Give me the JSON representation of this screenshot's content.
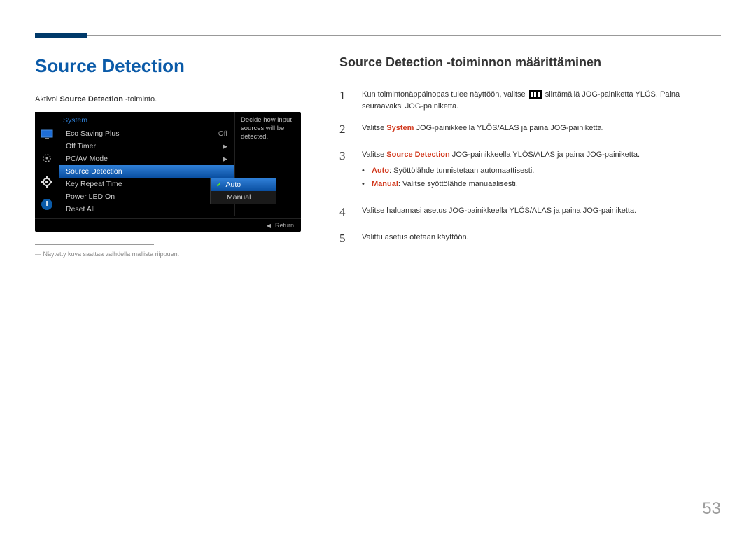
{
  "page_number": "53",
  "left": {
    "title": "Source Detection",
    "intro_pre": "Aktivoi ",
    "intro_bold": "Source Detection",
    "intro_post": " -toiminto.",
    "footnote": "Näytetty kuva saattaa vaihdella mallista riippuen."
  },
  "osd": {
    "header": "System",
    "rows": {
      "eco": "Eco Saving Plus",
      "eco_val": "Off",
      "offtimer": "Off Timer",
      "pcav": "PC/AV Mode",
      "srcdet": "Source Detection",
      "keyrep": "Key Repeat Time",
      "pled": "Power LED On",
      "reset": "Reset All"
    },
    "help": "Decide how input sources will be detected.",
    "dropdown": {
      "auto": "Auto",
      "manual": "Manual"
    },
    "return": "Return"
  },
  "right": {
    "heading": "Source Detection -toiminnon määrittäminen",
    "step1_a": "Kun toimintonäppäinopas tulee näyttöön, valitse ",
    "step1_b": " siirtämällä JOG-painiketta YLÖS. Paina seuraavaksi JOG-painiketta.",
    "step2_a": "Valitse ",
    "step2_sys": "System",
    "step2_b": " JOG-painikkeella YLÖS/ALAS ja paina JOG-painiketta.",
    "step3_a": "Valitse ",
    "step3_sd": "Source Detection",
    "step3_b": " JOG-painikkeella YLÖS/ALAS ja paina JOG-painiketta.",
    "bullet_auto_lbl": "Auto",
    "bullet_auto_txt": ": Syöttölähde tunnistetaan automaattisesti.",
    "bullet_man_lbl": "Manual",
    "bullet_man_txt": ": Valitse syöttölähde manuaalisesti.",
    "step4": "Valitse haluamasi asetus JOG-painikkeella YLÖS/ALAS ja paina JOG-painiketta.",
    "step5": "Valittu asetus otetaan käyttöön."
  }
}
